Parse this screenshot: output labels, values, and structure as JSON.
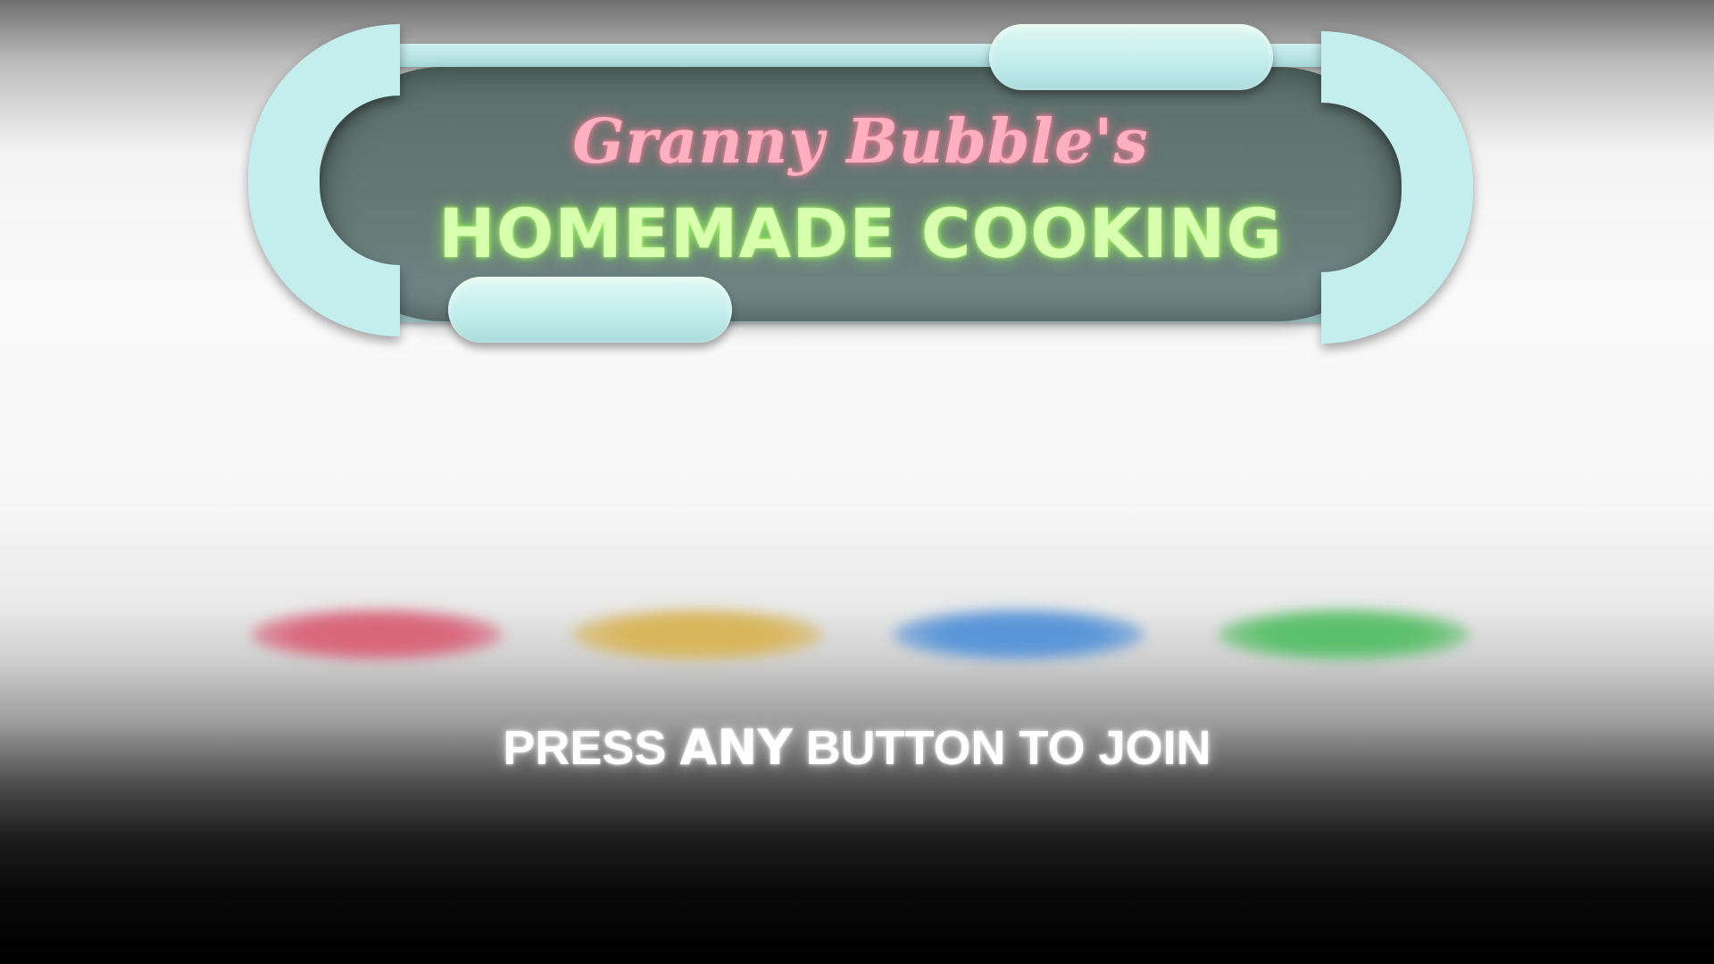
{
  "title": {
    "script_line": "Granny Bubble's",
    "main_line": "HOMEMADE COOKING"
  },
  "colors": {
    "sign_frame": "#c4eeee",
    "sign_panel": "#667a76",
    "script_text": "#ffb0c0",
    "main_text": "#d8ffae"
  },
  "player_slots": [
    {
      "label": "player-1",
      "color": "#d9667c"
    },
    {
      "label": "player-2",
      "color": "#d8b65c"
    },
    {
      "label": "player-3",
      "color": "#5a96d8"
    },
    {
      "label": "player-4",
      "color": "#5cc06b"
    }
  ],
  "prompt": {
    "before": "PRESS ",
    "emphasis": "ANY",
    "after": " BUTTON TO JOIN"
  }
}
